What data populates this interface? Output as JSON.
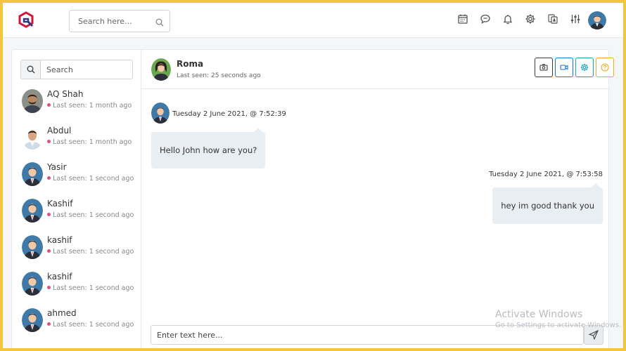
{
  "header": {
    "search_placeholder": "Search here...",
    "icons": [
      "calendar-icon",
      "chat-icon",
      "bell-icon",
      "gear-icon",
      "translate-icon",
      "sliders-icon"
    ],
    "brand_color": "#d0173a",
    "accent_color": "#2d3a7c"
  },
  "sidebar": {
    "search_placeholder": "Search",
    "contacts": [
      {
        "name": "AQ Shah",
        "last_seen": "Last seen: 1 month ago"
      },
      {
        "name": "Abdul",
        "last_seen": "Last seen: 1 month ago"
      },
      {
        "name": "Yasir",
        "last_seen": "Last seen: 1 second ago"
      },
      {
        "name": "Kashif",
        "last_seen": "Last seen: 1 second ago"
      },
      {
        "name": "kashif",
        "last_seen": "Last seen: 1 second ago"
      },
      {
        "name": "kashif",
        "last_seen": "Last seen: 1 second ago"
      },
      {
        "name": "ahmed",
        "last_seen": "Last seen: 1 second ago"
      }
    ],
    "status_dot_color": "#e0537a"
  },
  "chat": {
    "contact_name": "Roma",
    "contact_last_seen": "Last seen: 25 seconds ago",
    "header_buttons": [
      "camera-icon",
      "video-icon",
      "gear-icon",
      "help-icon"
    ],
    "messages": [
      {
        "direction": "incoming",
        "timestamp": "Tuesday 2 June 2021, @ 7:52:39",
        "text": "Hello John how are you?"
      },
      {
        "direction": "outgoing",
        "timestamp": "Tuesday 2 June 2021, @ 7:53:58",
        "text": "hey im good thank you"
      }
    ],
    "composer_placeholder": "Enter text here..."
  },
  "watermark": {
    "line1": "Activate Windows",
    "line2": "Go to Settings to activate Windows."
  }
}
